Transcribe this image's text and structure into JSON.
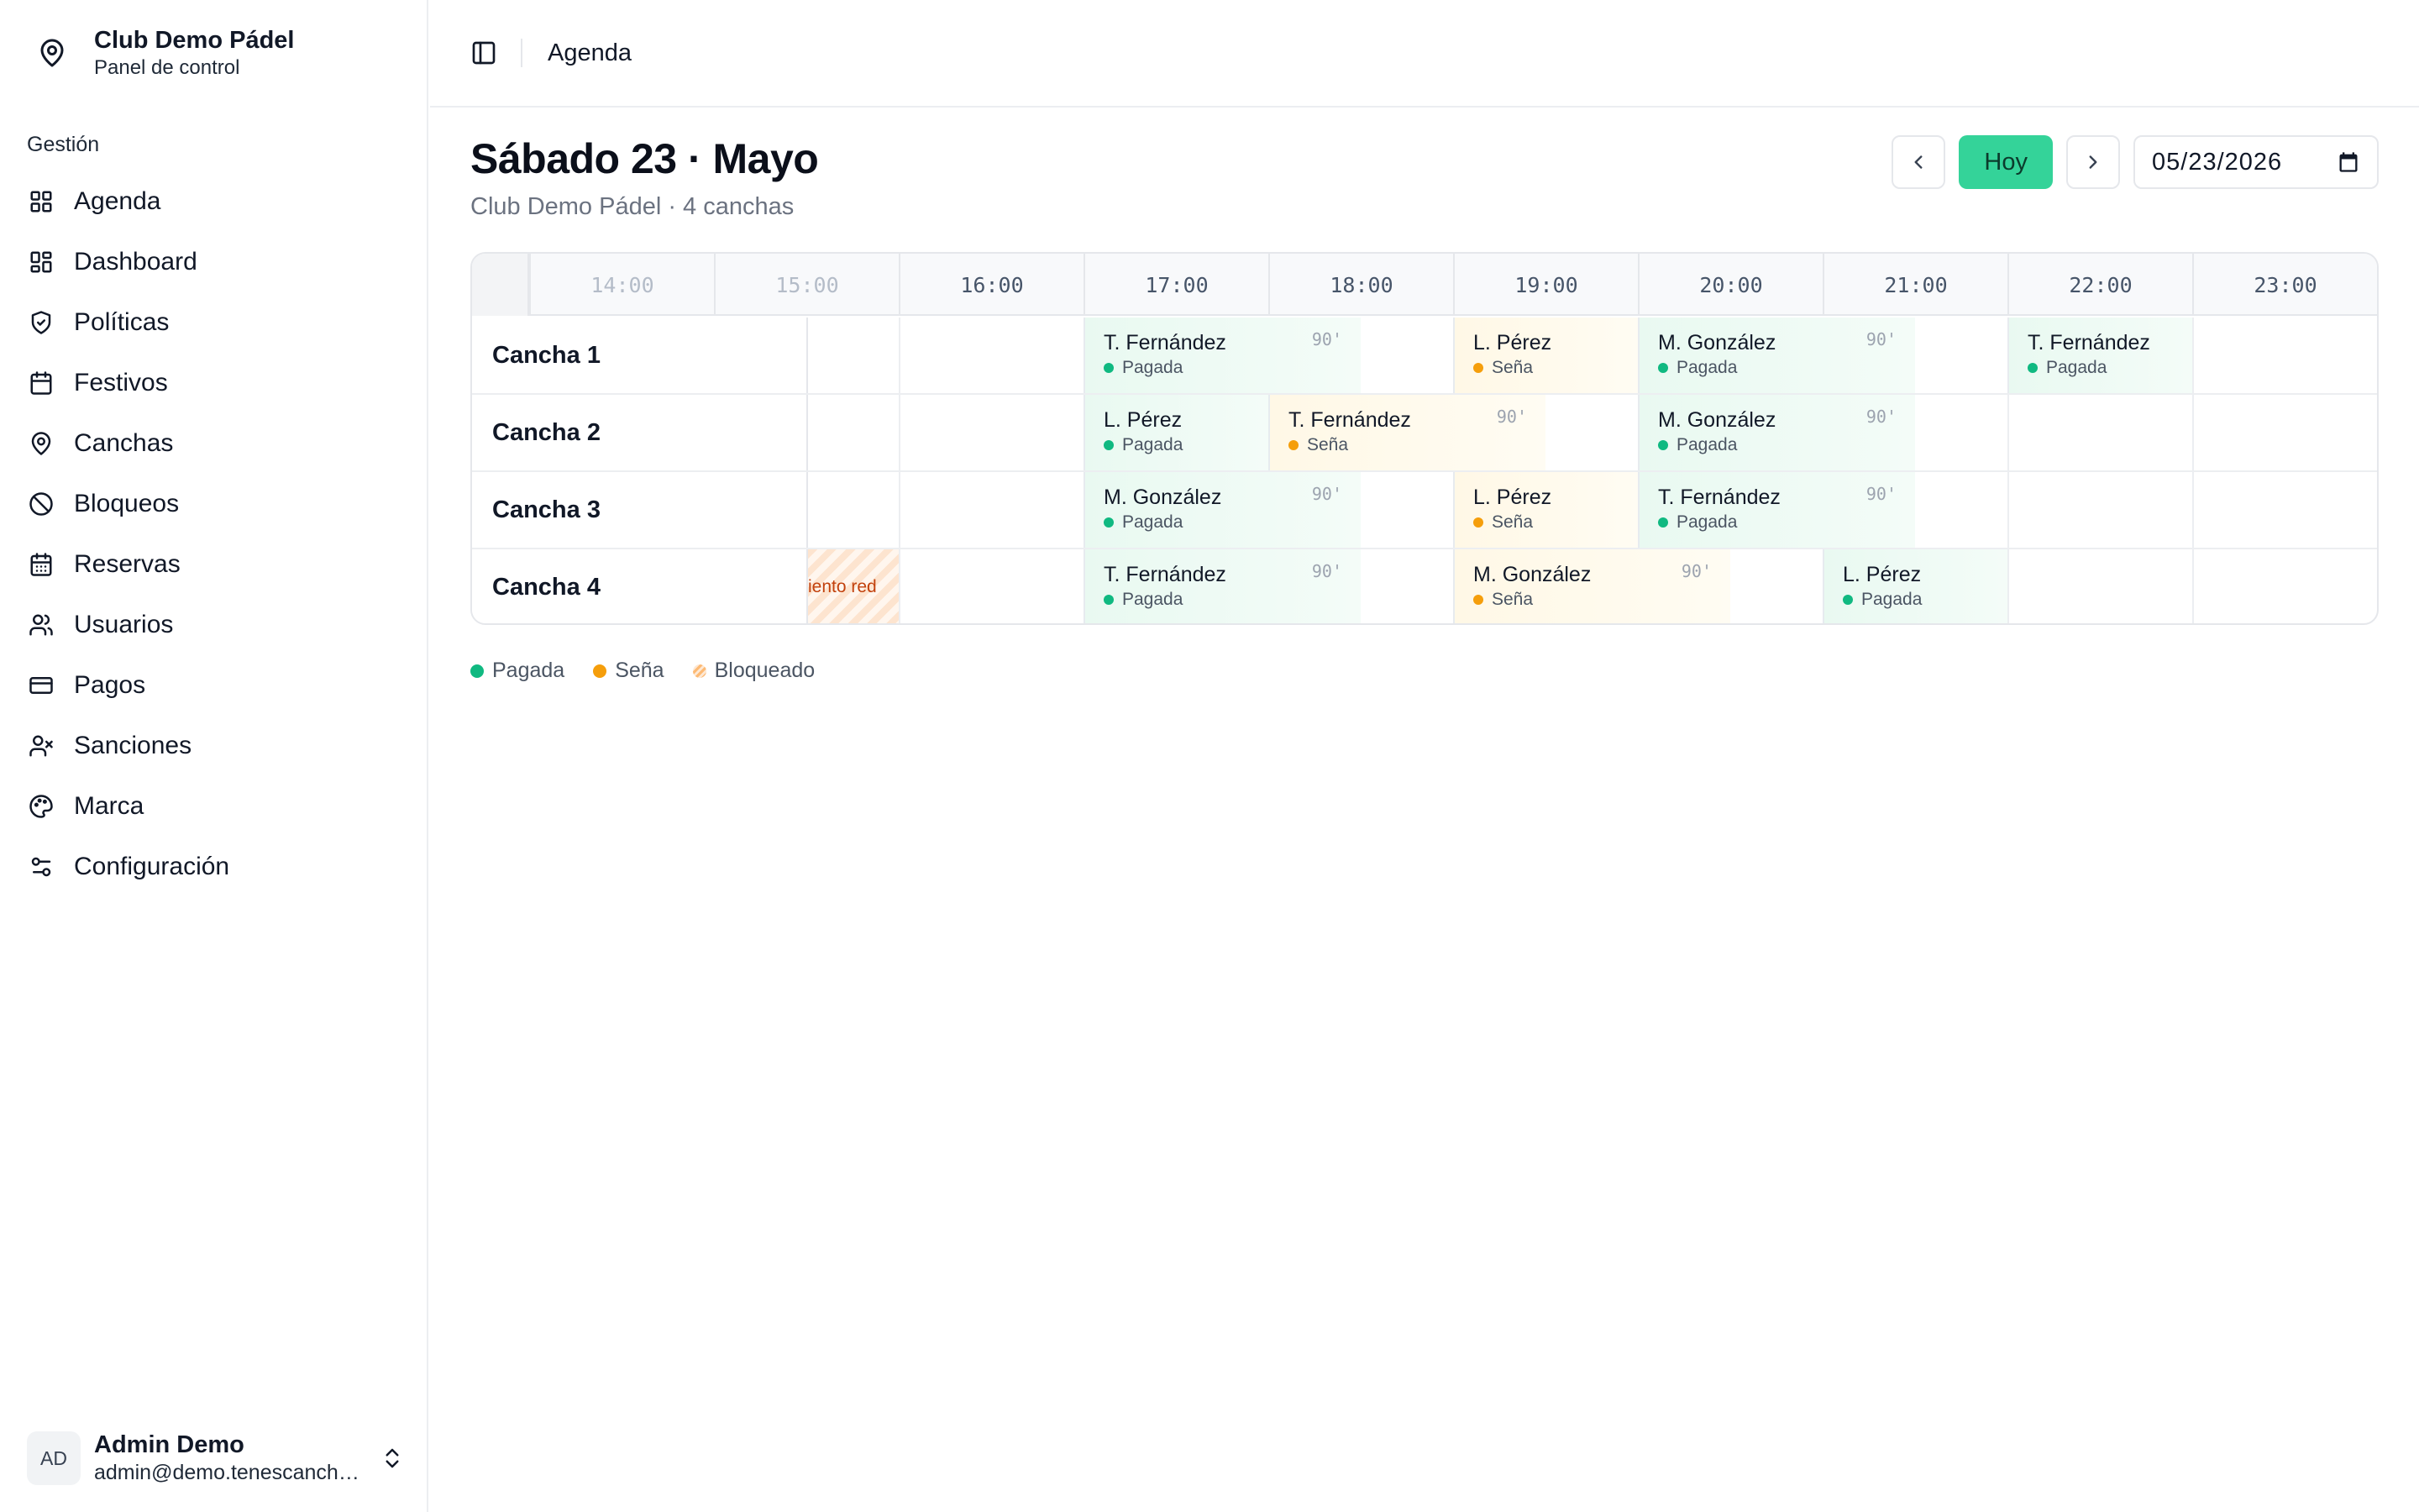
{
  "brand": {
    "title": "Club Demo Pádel",
    "subtitle": "Panel de control"
  },
  "sidebar": {
    "group_label": "Gestión",
    "items": [
      {
        "label": "Agenda",
        "icon": "grid-icon"
      },
      {
        "label": "Dashboard",
        "icon": "dashboard-icon"
      },
      {
        "label": "Políticas",
        "icon": "shield-check-icon"
      },
      {
        "label": "Festivos",
        "icon": "calendar-icon"
      },
      {
        "label": "Canchas",
        "icon": "map-pin-icon"
      },
      {
        "label": "Bloqueos",
        "icon": "ban-icon"
      },
      {
        "label": "Reservas",
        "icon": "calendar-days-icon"
      },
      {
        "label": "Usuarios",
        "icon": "users-icon"
      },
      {
        "label": "Pagos",
        "icon": "credit-card-icon"
      },
      {
        "label": "Sanciones",
        "icon": "user-x-icon"
      },
      {
        "label": "Marca",
        "icon": "palette-icon"
      },
      {
        "label": "Configuración",
        "icon": "sliders-icon"
      }
    ]
  },
  "user": {
    "initials": "AD",
    "name": "Admin Demo",
    "email": "admin@demo.tenescanchas.com"
  },
  "topbar": {
    "breadcrumb": "Agenda"
  },
  "header": {
    "title": "Sábado 23 · Mayo",
    "subtitle": "Club Demo Pádel · 4 canchas",
    "today_label": "Hoy",
    "date_value": "05/23/2026"
  },
  "schedule": {
    "hours": [
      "14:00",
      "15:00",
      "16:00",
      "17:00",
      "18:00",
      "19:00",
      "20:00",
      "21:00",
      "22:00",
      "23:00"
    ],
    "courts": [
      {
        "name": "Cancha 1",
        "bookings": [
          {
            "name": "T. Fernández",
            "duration": "90'",
            "status": "Pagada",
            "kind": "paid",
            "start": 17,
            "span": 1.5
          },
          {
            "name": "L. Pérez",
            "duration": "",
            "status": "Seña",
            "kind": "deposit",
            "start": 19,
            "span": 1
          },
          {
            "name": "M. González",
            "duration": "90'",
            "status": "Pagada",
            "kind": "paid",
            "start": 20,
            "span": 1.5
          },
          {
            "name": "T. Fernández",
            "duration": "",
            "status": "Pagada",
            "kind": "paid",
            "start": 22,
            "span": 1
          }
        ]
      },
      {
        "name": "Cancha 2",
        "bookings": [
          {
            "name": "L. Pérez",
            "duration": "",
            "status": "Pagada",
            "kind": "paid",
            "start": 17,
            "span": 1
          },
          {
            "name": "T. Fernández",
            "duration": "90'",
            "status": "Seña",
            "kind": "deposit",
            "start": 18,
            "span": 1.5
          },
          {
            "name": "M. González",
            "duration": "90'",
            "status": "Pagada",
            "kind": "paid",
            "start": 20,
            "span": 1.5
          }
        ]
      },
      {
        "name": "Cancha 3",
        "bookings": [
          {
            "name": "M. González",
            "duration": "90'",
            "status": "Pagada",
            "kind": "paid",
            "start": 17,
            "span": 1.5
          },
          {
            "name": "L. Pérez",
            "duration": "",
            "status": "Seña",
            "kind": "deposit",
            "start": 19,
            "span": 1
          },
          {
            "name": "T. Fernández",
            "duration": "90'",
            "status": "Pagada",
            "kind": "paid",
            "start": 20,
            "span": 1.5
          }
        ]
      },
      {
        "name": "Cancha 4",
        "block": {
          "label": "iento red",
          "start": 15,
          "span": 0.5
        },
        "bookings": [
          {
            "name": "T. Fernández",
            "duration": "90'",
            "status": "Pagada",
            "kind": "paid",
            "start": 17,
            "span": 1.5
          },
          {
            "name": "M. González",
            "duration": "90'",
            "status": "Seña",
            "kind": "deposit",
            "start": 19,
            "span": 1.5
          },
          {
            "name": "L. Pérez",
            "duration": "",
            "status": "Pagada",
            "kind": "paid",
            "start": 21,
            "span": 1
          }
        ]
      }
    ]
  },
  "legend": [
    {
      "label": "Pagada",
      "kind": "paid"
    },
    {
      "label": "Seña",
      "kind": "deposit"
    },
    {
      "label": "Bloqueado",
      "kind": "blocked"
    }
  ],
  "colors": {
    "paid": "#10b981",
    "deposit": "#f59e0b",
    "accent": "#34d399"
  }
}
